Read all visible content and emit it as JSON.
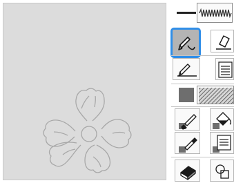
{
  "canvas": {
    "background_color": "#dcdcdc",
    "design": "flower-outline"
  },
  "toolbar": {
    "accent_color": "#2f8ee8",
    "items": [
      {
        "name": "line-type-button",
        "icon": "zigzag-line-icon",
        "selected": false
      },
      {
        "name": "line-draw-button",
        "icon": "pencil-line-icon",
        "selected": true
      },
      {
        "name": "line-eraser-button",
        "icon": "eraser-line-icon",
        "selected": false
      },
      {
        "name": "freehand-line-button",
        "icon": "freehand-pen-icon",
        "selected": false
      },
      {
        "name": "line-properties-button",
        "icon": "document-lines-icon",
        "selected": false
      },
      {
        "name": "fill-pattern-button",
        "icon": "fill-pattern-icon",
        "selected": false
      },
      {
        "name": "brush-fill-button",
        "icon": "paint-brush-icon",
        "selected": false
      },
      {
        "name": "bucket-fill-button",
        "icon": "paint-bucket-icon",
        "selected": false
      },
      {
        "name": "eyedropper-button",
        "icon": "eyedropper-icon",
        "selected": false
      },
      {
        "name": "fill-properties-button",
        "icon": "document-fill-icon",
        "selected": false
      },
      {
        "name": "eraser-button",
        "icon": "eraser-icon",
        "selected": false
      },
      {
        "name": "shape-button",
        "icon": "shapes-icon",
        "selected": false
      }
    ]
  }
}
